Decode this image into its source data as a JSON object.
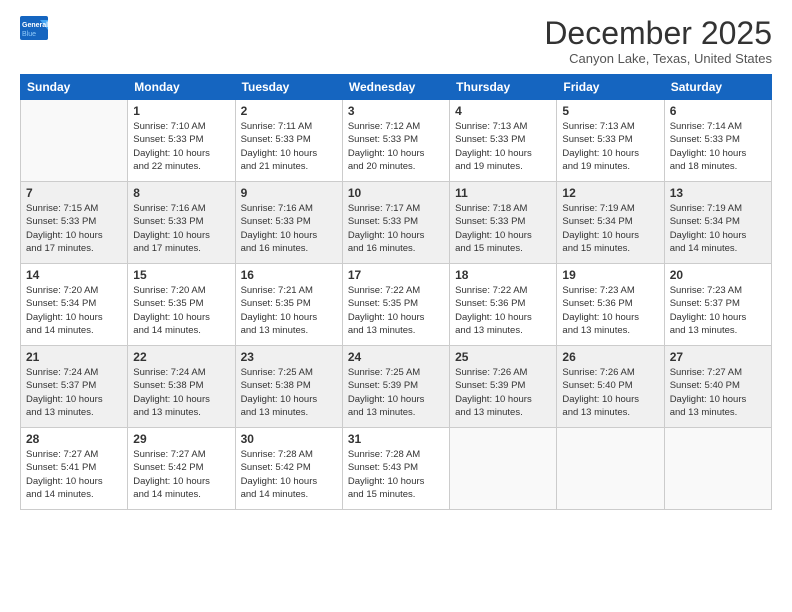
{
  "header": {
    "logo_line1": "General",
    "logo_line2": "Blue",
    "month": "December 2025",
    "location": "Canyon Lake, Texas, United States"
  },
  "weekdays": [
    "Sunday",
    "Monday",
    "Tuesday",
    "Wednesday",
    "Thursday",
    "Friday",
    "Saturday"
  ],
  "weeks": [
    [
      {
        "day": "",
        "info": ""
      },
      {
        "day": "1",
        "info": "Sunrise: 7:10 AM\nSunset: 5:33 PM\nDaylight: 10 hours\nand 22 minutes."
      },
      {
        "day": "2",
        "info": "Sunrise: 7:11 AM\nSunset: 5:33 PM\nDaylight: 10 hours\nand 21 minutes."
      },
      {
        "day": "3",
        "info": "Sunrise: 7:12 AM\nSunset: 5:33 PM\nDaylight: 10 hours\nand 20 minutes."
      },
      {
        "day": "4",
        "info": "Sunrise: 7:13 AM\nSunset: 5:33 PM\nDaylight: 10 hours\nand 19 minutes."
      },
      {
        "day": "5",
        "info": "Sunrise: 7:13 AM\nSunset: 5:33 PM\nDaylight: 10 hours\nand 19 minutes."
      },
      {
        "day": "6",
        "info": "Sunrise: 7:14 AM\nSunset: 5:33 PM\nDaylight: 10 hours\nand 18 minutes."
      }
    ],
    [
      {
        "day": "7",
        "info": "Sunrise: 7:15 AM\nSunset: 5:33 PM\nDaylight: 10 hours\nand 17 minutes."
      },
      {
        "day": "8",
        "info": "Sunrise: 7:16 AM\nSunset: 5:33 PM\nDaylight: 10 hours\nand 17 minutes."
      },
      {
        "day": "9",
        "info": "Sunrise: 7:16 AM\nSunset: 5:33 PM\nDaylight: 10 hours\nand 16 minutes."
      },
      {
        "day": "10",
        "info": "Sunrise: 7:17 AM\nSunset: 5:33 PM\nDaylight: 10 hours\nand 16 minutes."
      },
      {
        "day": "11",
        "info": "Sunrise: 7:18 AM\nSunset: 5:33 PM\nDaylight: 10 hours\nand 15 minutes."
      },
      {
        "day": "12",
        "info": "Sunrise: 7:19 AM\nSunset: 5:34 PM\nDaylight: 10 hours\nand 15 minutes."
      },
      {
        "day": "13",
        "info": "Sunrise: 7:19 AM\nSunset: 5:34 PM\nDaylight: 10 hours\nand 14 minutes."
      }
    ],
    [
      {
        "day": "14",
        "info": "Sunrise: 7:20 AM\nSunset: 5:34 PM\nDaylight: 10 hours\nand 14 minutes."
      },
      {
        "day": "15",
        "info": "Sunrise: 7:20 AM\nSunset: 5:35 PM\nDaylight: 10 hours\nand 14 minutes."
      },
      {
        "day": "16",
        "info": "Sunrise: 7:21 AM\nSunset: 5:35 PM\nDaylight: 10 hours\nand 13 minutes."
      },
      {
        "day": "17",
        "info": "Sunrise: 7:22 AM\nSunset: 5:35 PM\nDaylight: 10 hours\nand 13 minutes."
      },
      {
        "day": "18",
        "info": "Sunrise: 7:22 AM\nSunset: 5:36 PM\nDaylight: 10 hours\nand 13 minutes."
      },
      {
        "day": "19",
        "info": "Sunrise: 7:23 AM\nSunset: 5:36 PM\nDaylight: 10 hours\nand 13 minutes."
      },
      {
        "day": "20",
        "info": "Sunrise: 7:23 AM\nSunset: 5:37 PM\nDaylight: 10 hours\nand 13 minutes."
      }
    ],
    [
      {
        "day": "21",
        "info": "Sunrise: 7:24 AM\nSunset: 5:37 PM\nDaylight: 10 hours\nand 13 minutes."
      },
      {
        "day": "22",
        "info": "Sunrise: 7:24 AM\nSunset: 5:38 PM\nDaylight: 10 hours\nand 13 minutes."
      },
      {
        "day": "23",
        "info": "Sunrise: 7:25 AM\nSunset: 5:38 PM\nDaylight: 10 hours\nand 13 minutes."
      },
      {
        "day": "24",
        "info": "Sunrise: 7:25 AM\nSunset: 5:39 PM\nDaylight: 10 hours\nand 13 minutes."
      },
      {
        "day": "25",
        "info": "Sunrise: 7:26 AM\nSunset: 5:39 PM\nDaylight: 10 hours\nand 13 minutes."
      },
      {
        "day": "26",
        "info": "Sunrise: 7:26 AM\nSunset: 5:40 PM\nDaylight: 10 hours\nand 13 minutes."
      },
      {
        "day": "27",
        "info": "Sunrise: 7:27 AM\nSunset: 5:40 PM\nDaylight: 10 hours\nand 13 minutes."
      }
    ],
    [
      {
        "day": "28",
        "info": "Sunrise: 7:27 AM\nSunset: 5:41 PM\nDaylight: 10 hours\nand 14 minutes."
      },
      {
        "day": "29",
        "info": "Sunrise: 7:27 AM\nSunset: 5:42 PM\nDaylight: 10 hours\nand 14 minutes."
      },
      {
        "day": "30",
        "info": "Sunrise: 7:28 AM\nSunset: 5:42 PM\nDaylight: 10 hours\nand 14 minutes."
      },
      {
        "day": "31",
        "info": "Sunrise: 7:28 AM\nSunset: 5:43 PM\nDaylight: 10 hours\nand 15 minutes."
      },
      {
        "day": "",
        "info": ""
      },
      {
        "day": "",
        "info": ""
      },
      {
        "day": "",
        "info": ""
      }
    ]
  ]
}
